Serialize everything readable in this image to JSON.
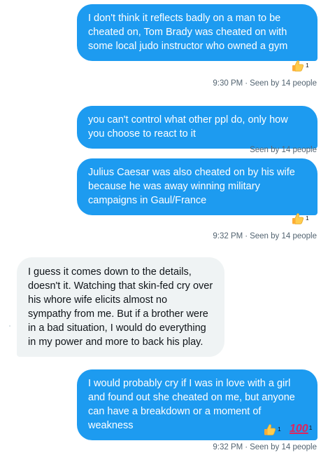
{
  "messages": [
    {
      "text": "I don't think it reflects badly on a man to be cheated on, Tom Brady was cheated on with some local judo instructor who owned a gym",
      "reaction_count": "1",
      "time": "9:30 PM",
      "seen": "Seen by 14 people"
    },
    {
      "text": "you can't control what other ppl do, only how you choose to react to it",
      "seen": "Seen by 14 people"
    },
    {
      "text": "Julius Caesar was also cheated on by his wife because he was away winning military campaigns in Gaul/France",
      "reaction_count": "1",
      "time": "9:32 PM",
      "seen": "Seen by 14 people"
    },
    {
      "text": "I guess it comes down to the details, doesn't it. Watching that skin-fed cry over his whore wife elicits almost no sympathy from me. But if a brother were in a bad situation, I would do everything in my power and more to back his play."
    },
    {
      "text": "I would probably cry if I was in love with a girl and found out she cheated on me, but anyone can have a breakdown or a moment of weakness",
      "reactions": [
        {
          "icon": "thumbs-up-icon",
          "count": "1"
        },
        {
          "icon": "hundred-points-icon",
          "glyph": "100",
          "count": "1"
        }
      ],
      "time": "9:32 PM",
      "seen": "Seen by 14 people"
    }
  ],
  "separator": "·",
  "colors": {
    "sent_bubble": "#1d9bf0",
    "received_bubble": "#eff3f4",
    "meta_text": "#536471"
  }
}
